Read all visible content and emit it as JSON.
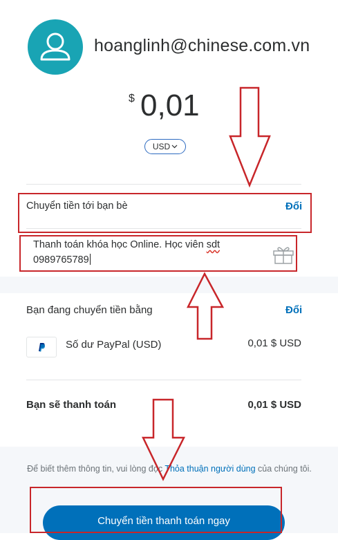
{
  "account": {
    "email": "hoanglinh@chinese.com.vn"
  },
  "amount": {
    "symbol": "$",
    "value": "0,01",
    "currency_selector": "USD"
  },
  "recipient": {
    "label": "Chuyển tiền tới bạn bè",
    "change": "Đổi"
  },
  "note": {
    "text_before": "Thanh toán khóa học Online. Học viên ",
    "spellcheck_word": "sdt",
    "text_after": "0989765789"
  },
  "funding": {
    "label": "Bạn đang chuyển tiền bằng",
    "change": "Đổi",
    "source_name": "Số dư PayPal (USD)",
    "source_amount": "0,01 $ USD"
  },
  "total": {
    "label": "Bạn sẽ thanh toán",
    "amount": "0,01 $ USD"
  },
  "footer": {
    "text_before": "Để biết thêm thông tin, vui lòng đọc ",
    "link": "Thỏa thuận người dùng",
    "text_after": " của chúng tôi."
  },
  "pay_button": "Chuyển tiền thanh toán ngay",
  "colors": {
    "avatar": "#19a4b4",
    "link": "#0070ba",
    "annotation": "#c8262a"
  }
}
